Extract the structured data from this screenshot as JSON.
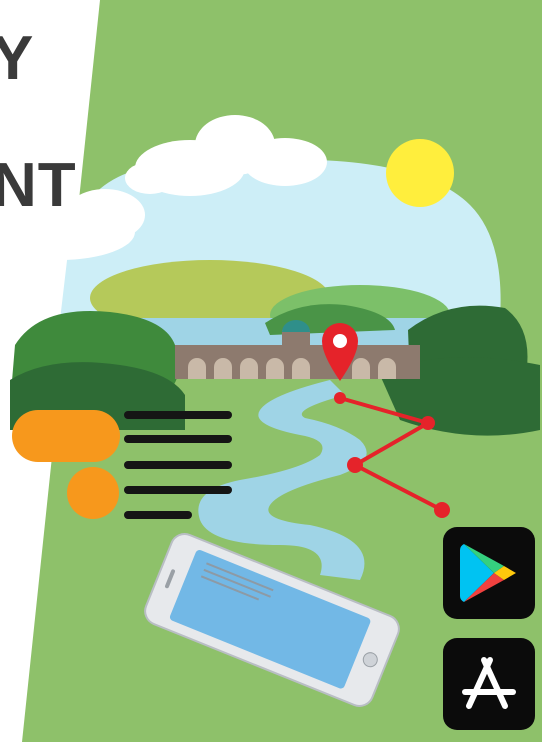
{
  "headline": {
    "line1": "Y",
    "line2": "NT"
  },
  "colors": {
    "grass": "#8ec16a",
    "sky": "#cdeef7",
    "water": "#9fd4e6",
    "bridge": "#8d7a6e",
    "route": "#e5232a",
    "sun": "#ffee3d",
    "orange": "#f7981c",
    "tree_dark": "#2e6b35",
    "tree_mid": "#3f8a3c",
    "hill": "#b5c95a",
    "phone_screen": "#72b8e6"
  },
  "icons": {
    "play_store": "google-play-icon",
    "app_store": "app-store-icon",
    "map_pin": "location-pin-icon",
    "smartphone": "smartphone-icon"
  }
}
